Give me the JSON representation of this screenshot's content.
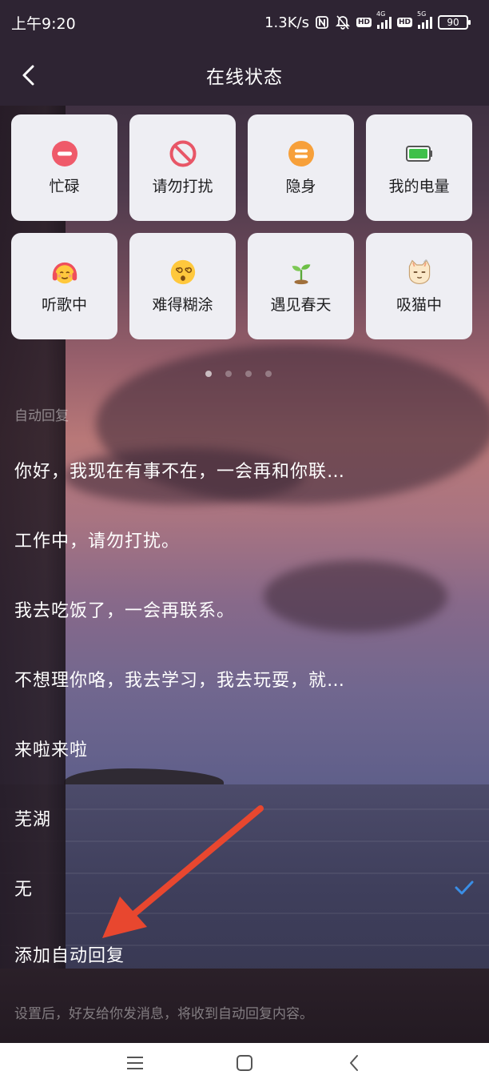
{
  "status_bar": {
    "time": "上午9:20",
    "speed": "1.3K/s",
    "battery": "90",
    "net_4g": "4G",
    "net_5g": "5G",
    "hd": "HD"
  },
  "header": {
    "title": "在线状态"
  },
  "statuses": [
    {
      "label": "忙碌",
      "icon": "busy-icon"
    },
    {
      "label": "请勿打扰",
      "icon": "do-not-disturb-icon"
    },
    {
      "label": "隐身",
      "icon": "invisible-icon"
    },
    {
      "label": "我的电量",
      "icon": "battery-icon"
    },
    {
      "label": "听歌中",
      "icon": "headphones-emoji-icon"
    },
    {
      "label": "难得糊涂",
      "icon": "dizzy-emoji-icon"
    },
    {
      "label": "遇见春天",
      "icon": "sprout-icon"
    },
    {
      "label": "吸猫中",
      "icon": "cat-icon"
    }
  ],
  "pager": {
    "pages": 4,
    "active_index": 0
  },
  "auto_reply": {
    "section_label": "自动回复",
    "items": [
      {
        "text": "你好，我现在有事不在，一会再和你联…",
        "selected": false
      },
      {
        "text": "工作中，请勿打扰。",
        "selected": false
      },
      {
        "text": "我去吃饭了，一会再联系。",
        "selected": false
      },
      {
        "text": "不想理你咯，我去学习，我去玩耍，就…",
        "selected": false
      },
      {
        "text": "来啦来啦",
        "selected": false
      },
      {
        "text": "芜湖",
        "selected": false
      },
      {
        "text": "无",
        "selected": true
      }
    ],
    "add_label": "添加自动回复",
    "hint": "设置后，好友给你发消息，将收到自动回复内容。"
  },
  "colors": {
    "accent_check": "#3a8ee6",
    "annotation_arrow": "#e8472f"
  }
}
